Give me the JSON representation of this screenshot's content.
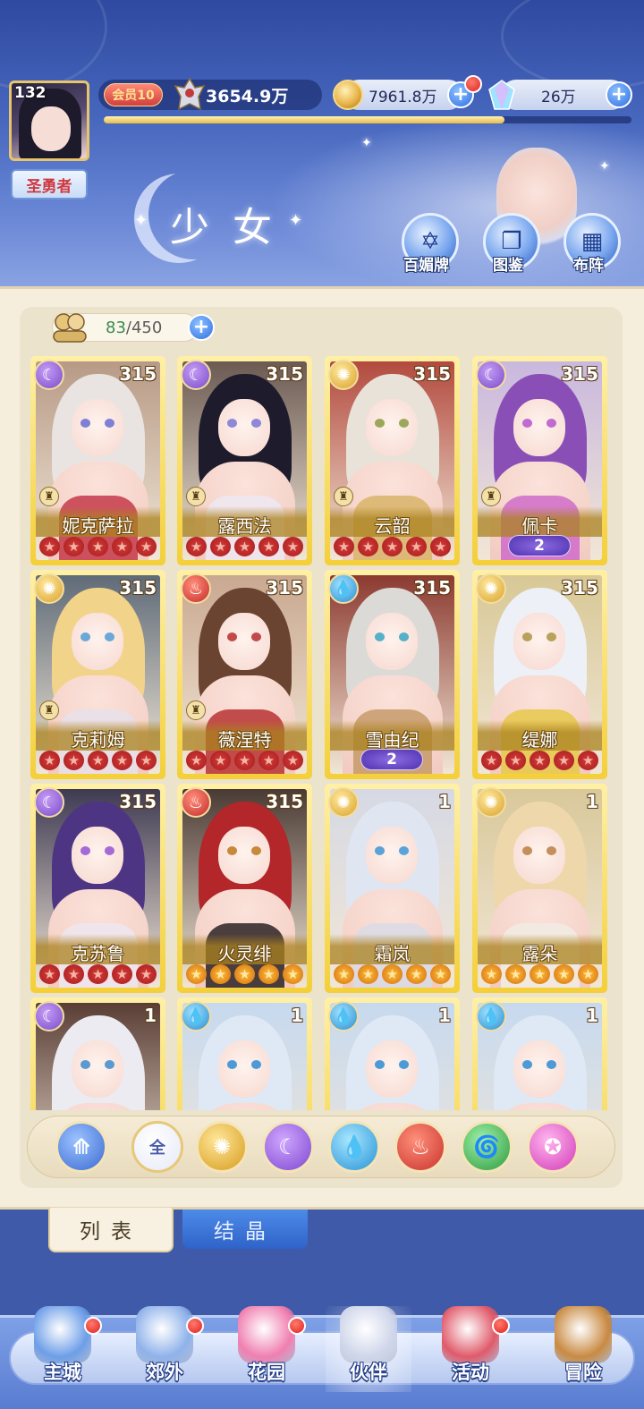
{
  "player": {
    "level": "132",
    "title": "圣勇者",
    "vip": "会员10",
    "power": "3654.9万",
    "exp_fraction": 0.76
  },
  "resources": {
    "coins": "7961.8万",
    "gems": "26万",
    "plus": "+"
  },
  "page": {
    "heading": "少女"
  },
  "header_buttons": [
    {
      "label": "百媚牌",
      "icon": "hexagram-book-icon"
    },
    {
      "label": "图鉴",
      "icon": "open-book-icon"
    },
    {
      "label": "布阵",
      "icon": "formation-grid-icon"
    }
  ],
  "roster": {
    "owned": "83",
    "capacity": "/450",
    "plus": "+"
  },
  "characters": [
    {
      "name": "妮克萨拉",
      "level": "315",
      "element": "moon",
      "stars": 5,
      "star_color": "red",
      "awaken": "",
      "rank": true,
      "hair": "#e9e4e2",
      "outfit": "#c63a4a",
      "eye": "#7f7fd6",
      "bg": "#b79a86"
    },
    {
      "name": "露西法",
      "level": "315",
      "element": "moon",
      "stars": 5,
      "star_color": "red",
      "awaken": "",
      "rank": true,
      "hair": "#1e1b2c",
      "outfit": "#efe8f2",
      "eye": "#8e88d8",
      "bg": "#6b5a52"
    },
    {
      "name": "云韶",
      "level": "315",
      "element": "sun",
      "stars": 5,
      "star_color": "red",
      "awaken": "",
      "rank": true,
      "hair": "#e8e2d8",
      "outfit": "#d9b46a",
      "eye": "#9ba85a",
      "bg": "#b24a3e"
    },
    {
      "name": "佩卡",
      "level": "315",
      "element": "moon",
      "stars": 0,
      "star_color": "red",
      "awaken": "2",
      "rank": true,
      "hair": "#8a4fb7",
      "outfit": "#cf6bc9",
      "eye": "#c06ad2",
      "bg": "#c9b8de"
    },
    {
      "name": "克莉姆",
      "level": "315",
      "element": "sun",
      "stars": 5,
      "star_color": "red",
      "awaken": "",
      "rank": true,
      "hair": "#f2d38a",
      "outfit": "#e8e0ea",
      "eye": "#6aa8d8",
      "bg": "#5f6b78"
    },
    {
      "name": "薇涅特",
      "level": "315",
      "element": "fire",
      "stars": 5,
      "star_color": "red",
      "awaken": "",
      "rank": true,
      "hair": "#6b4431",
      "outfit": "#b83232",
      "eye": "#c34a4a",
      "bg": "#c9a890"
    },
    {
      "name": "雪由纪",
      "level": "315",
      "element": "water",
      "stars": 0,
      "star_color": "red",
      "awaken": "2",
      "rank": false,
      "hair": "#dcdad6",
      "outfit": "#c79a6a",
      "eye": "#55b0c8",
      "bg": "#8c3a30"
    },
    {
      "name": "缇娜",
      "level": "315",
      "element": "sun",
      "stars": 5,
      "star_color": "red",
      "awaken": "",
      "rank": false,
      "hair": "#edf0f6",
      "outfit": "#e7c84a",
      "eye": "#b8a25a",
      "bg": "#d8c896"
    },
    {
      "name": "克苏鲁",
      "level": "315",
      "element": "moon",
      "stars": 5,
      "star_color": "red",
      "awaken": "",
      "rank": false,
      "hair": "#4d3584",
      "outfit": "#efe6f0",
      "eye": "#a46ad6",
      "bg": "#3e3a52"
    },
    {
      "name": "火灵绯",
      "level": "315",
      "element": "fire",
      "stars": 5,
      "star_color": "gold",
      "awaken": "",
      "rank": false,
      "hair": "#b3262a",
      "outfit": "#2b2224",
      "eye": "#c7893a",
      "bg": "#4a3a34"
    },
    {
      "name": "霜岚",
      "level": "1",
      "element": "sun",
      "stars": 5,
      "star_color": "gold",
      "awaken": "",
      "rank": false,
      "hair": "#dfe6f2",
      "outfit": "#d9dbe6",
      "eye": "#5aa3d8",
      "bg": "#d6d9e4"
    },
    {
      "name": "露朵",
      "level": "1",
      "element": "sun",
      "stars": 5,
      "star_color": "gold",
      "awaken": "",
      "rank": false,
      "hair": "#efd7ac",
      "outfit": "#f1ece4",
      "eye": "#c58f5a",
      "bg": "#d9c89a"
    },
    {
      "name": "",
      "level": "1",
      "element": "moon",
      "stars": 0,
      "star_color": "gold",
      "awaken": "",
      "rank": false,
      "hair": "#ecebf2",
      "outfit": "#3a2a2c",
      "eye": "#5a9ad0",
      "bg": "#5a3e36"
    },
    {
      "name": "",
      "level": "1",
      "element": "water",
      "stars": 0,
      "star_color": "gold",
      "awaken": "",
      "rank": false,
      "hair": "#dfe9f6",
      "outfit": "#9cc6ea",
      "eye": "#4c9bd6",
      "bg": "#c7d9ef"
    },
    {
      "name": "",
      "level": "1",
      "element": "water",
      "stars": 0,
      "star_color": "gold",
      "awaken": "",
      "rank": false,
      "hair": "#dfe9f6",
      "outfit": "#9cc6ea",
      "eye": "#4c9bd6",
      "bg": "#c7d9ef"
    },
    {
      "name": "",
      "level": "1",
      "element": "water",
      "stars": 0,
      "star_color": "gold",
      "awaken": "",
      "rank": false,
      "hair": "#dfe9f6",
      "outfit": "#9cc6ea",
      "eye": "#4c9bd6",
      "bg": "#c7d9ef"
    }
  ],
  "filters": [
    {
      "key": "sky",
      "label": "",
      "icon": "sky-arrow-icon"
    },
    {
      "key": "all",
      "label": "全",
      "icon": "all-filter-icon"
    },
    {
      "key": "sun",
      "label": "",
      "icon": "sun-element-icon"
    },
    {
      "key": "moon",
      "label": "",
      "icon": "moon-element-icon"
    },
    {
      "key": "water",
      "label": "",
      "icon": "water-element-icon"
    },
    {
      "key": "fire",
      "label": "",
      "icon": "fire-element-icon"
    },
    {
      "key": "wind",
      "label": "",
      "icon": "wind-element-icon"
    },
    {
      "key": "star",
      "label": "",
      "icon": "star-element-icon"
    }
  ],
  "tabs": {
    "list": "列表",
    "crystal": "结晶"
  },
  "nav": [
    {
      "label": "主城",
      "badge": true,
      "color": "#6d9ee8"
    },
    {
      "label": "郊外",
      "badge": true,
      "color": "#8fb2ea"
    },
    {
      "label": "花园",
      "badge": true,
      "color": "#f07fb0"
    },
    {
      "label": "伙伴",
      "badge": false,
      "color": "#cfd6ea"
    },
    {
      "label": "活动",
      "badge": true,
      "color": "#e05a6a"
    },
    {
      "label": "冒险",
      "badge": false,
      "color": "#c98a42"
    }
  ],
  "colors": {
    "accent_blue": "#2d6fe3",
    "card_gold": "#f4cf38",
    "badge_red": "#e0221d"
  }
}
